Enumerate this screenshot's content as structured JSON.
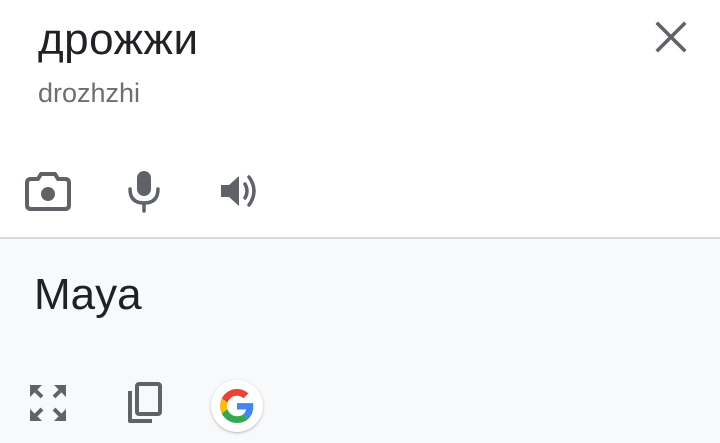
{
  "source": {
    "text": "дрожжи",
    "transliteration": "drozhzhi"
  },
  "result": {
    "text": "Maya"
  },
  "icons": {
    "close": "close-icon",
    "camera": "camera-icon",
    "mic": "microphone-icon",
    "speaker": "speaker-icon",
    "expand": "fullscreen-expand-icon",
    "copy": "copy-icon",
    "google": "google-logo-icon"
  },
  "colors": {
    "text_primary": "#202124",
    "text_secondary": "#6b6e72",
    "icon_gray": "#5f6368",
    "result_background": "#f8f9fa",
    "divider": "#dadce0",
    "google_blue": "#4285F4",
    "google_red": "#EA4335",
    "google_yellow": "#FBBC05",
    "google_green": "#34A853"
  }
}
